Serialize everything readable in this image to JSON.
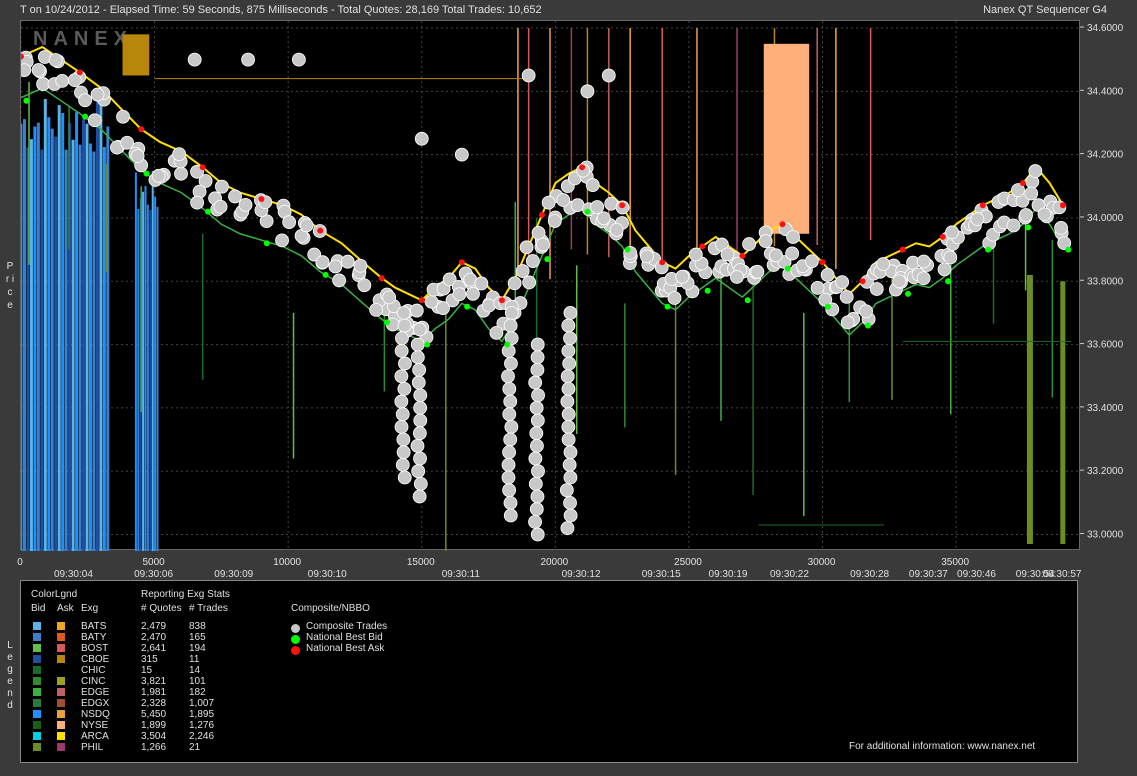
{
  "header": {
    "title": "T on 10/24/2012  -  Elapsed Time: 59 Seconds, 875 Milliseconds  -  Total Quotes: 28,169  Total Trades: 10,652",
    "app": "Nanex QT Sequencer G4"
  },
  "side": {
    "price": "P r i c e",
    "legend": "L e g e n d"
  },
  "watermark": "NANEX",
  "colors": {
    "bg": "#000000",
    "grid": "#444444",
    "trade": "#c8c8c8",
    "best_bid": "#00ff00",
    "best_ask": "#ff1010"
  },
  "chart_data": {
    "type": "scatter",
    "ylabel": "Price",
    "ylim": [
      32.97,
      34.6
    ],
    "xlim": [
      0,
      39300
    ],
    "y_ticks": [
      "34.6000",
      "34.4000",
      "34.2000",
      "34.0000",
      "33.8000",
      "33.6000",
      "33.4000",
      "33.2000",
      "33.0000"
    ],
    "x_ticks": [
      "0",
      "5000",
      "10000",
      "15000",
      "20000",
      "25000",
      "30000",
      "35000"
    ],
    "x_tick_values": [
      0,
      5000,
      10000,
      15000,
      20000,
      25000,
      30000,
      35000
    ],
    "time_ticks": [
      "09:30:04",
      "09:30:06",
      "09:30:09",
      "09:30:10",
      "09:30:11",
      "09:30:12",
      "09:30:15",
      "09:30:19",
      "09:30:22",
      "09:30:28",
      "09:30:37",
      "09:30:46",
      "09:30:54",
      "09:30:57"
    ],
    "time_tick_positions": [
      2000,
      5000,
      8000,
      11500,
      16500,
      21000,
      24000,
      26500,
      28800,
      31800,
      34000,
      35800,
      38000,
      39000
    ],
    "composite_trades": {
      "x": [
        0,
        800,
        1500,
        2200,
        3000,
        3800,
        4500,
        5200,
        6000,
        6800,
        7500,
        8200,
        9000,
        9800,
        10500,
        11200,
        12000,
        12800,
        13500,
        14000,
        14500,
        15000,
        15500,
        16000,
        16500,
        17000,
        17500,
        18000,
        18500,
        19000,
        19500,
        20000,
        20500,
        21000,
        21500,
        22000,
        22500,
        23000,
        23500,
        24000,
        24500,
        25000,
        25500,
        26000,
        26500,
        27000,
        27500,
        28000,
        28500,
        29000,
        29500,
        30000,
        30500,
        31000,
        31500,
        32000,
        32500,
        33000,
        33500,
        34000,
        34500,
        35000,
        35500,
        36000,
        36500,
        37000,
        37500,
        38000,
        38500,
        39000
      ],
      "y": [
        34.45,
        34.48,
        34.44,
        34.4,
        34.35,
        34.28,
        34.22,
        34.18,
        34.15,
        34.1,
        34.05,
        34.02,
        34.0,
        33.98,
        33.95,
        33.9,
        33.86,
        33.8,
        33.75,
        33.72,
        33.7,
        33.68,
        33.72,
        33.75,
        33.8,
        33.78,
        33.72,
        33.68,
        33.75,
        33.85,
        33.95,
        34.05,
        34.08,
        34.1,
        34.05,
        34.02,
        33.98,
        33.9,
        33.85,
        33.8,
        33.78,
        33.82,
        33.85,
        33.88,
        33.85,
        33.82,
        33.86,
        33.9,
        33.92,
        33.88,
        33.84,
        33.8,
        33.75,
        33.7,
        33.74,
        33.8,
        33.82,
        33.84,
        33.86,
        33.85,
        33.88,
        33.92,
        33.95,
        33.98,
        34.0,
        34.02,
        34.05,
        34.1,
        34.05,
        33.98
      ]
    },
    "ask_spikes_x": [
      18600,
      19000,
      19800,
      20600,
      21200,
      22000,
      22800,
      24000,
      25300,
      26800,
      28200,
      29800,
      30500,
      31800
    ],
    "bid_drops_x": [
      300,
      1800,
      3200,
      4500,
      6800,
      10200,
      13600,
      15900,
      18500,
      19300,
      20800,
      22600,
      24500,
      26200,
      27400,
      29300,
      31000,
      32600,
      34800,
      36400,
      37600,
      38600
    ]
  },
  "legend": {
    "head_colorlgnd": "ColorLgnd",
    "head_stats": "Reporting Exg Stats",
    "col_bid": "Bid",
    "col_ask": "Ask",
    "col_exg": "Exg",
    "col_quotes": "# Quotes",
    "col_trades": "# Trades",
    "composite_head": "Composite/NBBO",
    "composite_items": [
      "Composite Trades",
      "National Best Bid",
      "National Best Ask"
    ],
    "footer": "For additional information: www.nanex.net",
    "rows": [
      {
        "exg": "BATS",
        "quotes": "2,479",
        "trades": "838",
        "bid": "#5ab4e6",
        "ask": "#f5a623"
      },
      {
        "exg": "BATY",
        "quotes": "2,470",
        "trades": "165",
        "bid": "#3c7fc8",
        "ask": "#e05a1a"
      },
      {
        "exg": "BOST",
        "quotes": "2,641",
        "trades": "194",
        "bid": "#5fbf4a",
        "ask": "#d65a5a"
      },
      {
        "exg": "CBOE",
        "quotes": "315",
        "trades": "11",
        "bid": "#1f4fa0",
        "ask": "#b8860b"
      },
      {
        "exg": "CHIC",
        "quotes": "15",
        "trades": "14",
        "bid": "#1a6b2a",
        "ask": "#000000"
      },
      {
        "exg": "CINC",
        "quotes": "3,821",
        "trades": "101",
        "bid": "#2e8b2e",
        "ask": "#a0a020"
      },
      {
        "exg": "EDGE",
        "quotes": "1,981",
        "trades": "182",
        "bid": "#3cb043",
        "ask": "#c06060"
      },
      {
        "exg": "EDGX",
        "quotes": "2,328",
        "trades": "1,007",
        "bid": "#2a7a3a",
        "ask": "#a05030"
      },
      {
        "exg": "NSDQ",
        "quotes": "5,450",
        "trades": "1,895",
        "bid": "#1e90ff",
        "ask": "#e8a040"
      },
      {
        "exg": "NYSE",
        "quotes": "1,899",
        "trades": "1,276",
        "bid": "#1a5e1a",
        "ask": "#ffb07a"
      },
      {
        "exg": "ARCA",
        "quotes": "3,504",
        "trades": "2,246",
        "bid": "#00d0e0",
        "ask": "#ffe000"
      },
      {
        "exg": "PHIL",
        "quotes": "1,266",
        "trades": "21",
        "bid": "#6b8e23",
        "ask": "#9a3a6a"
      }
    ]
  }
}
